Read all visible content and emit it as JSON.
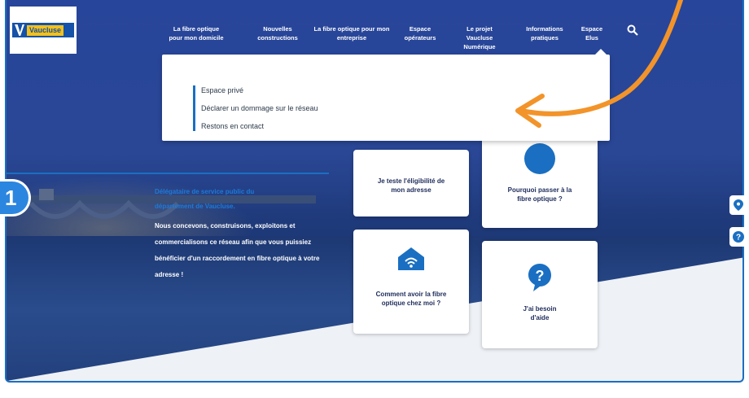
{
  "header": {
    "logo_text": "Vaucluse",
    "nav_items": [
      {
        "label": "La fibre optique pour mon domicile"
      },
      {
        "label": "Nouvelles constructions"
      },
      {
        "label": "La fibre optique pour mon entreprise"
      },
      {
        "label": "Espace opérateurs"
      },
      {
        "label": "Le projet Vaucluse Numérique"
      },
      {
        "label": "Informations pratiques"
      },
      {
        "label": "Espace Elus"
      }
    ]
  },
  "dropdown": {
    "items": [
      {
        "label": "Espace privé"
      },
      {
        "label": "Déclarer un dommage sur le réseau"
      },
      {
        "label": "Restons en contact"
      }
    ]
  },
  "hero": {
    "subtitle": "Délégataire de service public du département de Vaucluse.",
    "description": "Nous concevons, construisons, exploitons et commercialisons ce réseau afin que vous puissiez bénéficier d'un raccordement en fibre optique à votre adresse !"
  },
  "cards": [
    {
      "label": "Je teste l'éligibilité de mon adresse"
    },
    {
      "label": "Pourquoi passer à la fibre optique ?"
    },
    {
      "label": "Comment avoir la fibre optique chez moi ?"
    },
    {
      "label": "J'ai besoin d'aide"
    }
  ],
  "annotation": {
    "step_number": "1"
  },
  "colors": {
    "accent_blue": "#1a6fc2",
    "annotation_orange": "#f2942a",
    "logo_yellow": "#f3c11b",
    "hero_navy": "#213a86"
  },
  "icons": {
    "search": "search-icon",
    "wifi_house": "wifi-house-icon",
    "question_bubble": "question-bubble-icon",
    "map_pin": "map-pin-icon",
    "help": "help-icon"
  }
}
